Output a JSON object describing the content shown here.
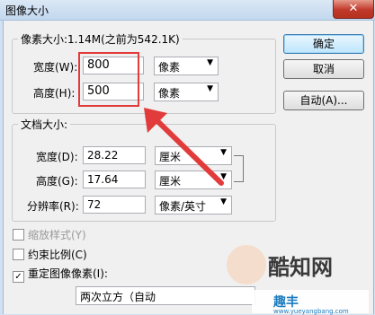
{
  "window": {
    "title": "图像大小",
    "close_symbol": "✕"
  },
  "pixel_dimensions": {
    "legend": "像素大小:1.14M(之前为542.1K)",
    "width_label": "宽度(W):",
    "width_value": "800",
    "width_unit": "像素",
    "height_label": "高度(H):",
    "height_value": "500",
    "height_unit": "像素"
  },
  "document_size": {
    "legend": "文档大小:",
    "width_label": "宽度(D):",
    "width_value": "28.22",
    "width_unit": "厘米",
    "height_label": "高度(G):",
    "height_value": "17.64",
    "height_unit": "厘米",
    "resolution_label": "分辨率(R):",
    "resolution_value": "72",
    "resolution_unit": "像素/英寸"
  },
  "buttons": {
    "ok": "确定",
    "cancel": "取消",
    "auto": "自动(A)..."
  },
  "options": {
    "scale_styles": "缩放样式(Y)",
    "constrain_proportions": "约束比例(C)",
    "resample": "重定图像像素(I):",
    "resample_checkmark": "✓",
    "resample_method": "两次立方（自动"
  },
  "watermark": {
    "brand1": "酷知网",
    "brand2": "趣丰",
    "brand2_url": "www.yueyangbang.com"
  },
  "annotation": {
    "color": "#e23b3b"
  }
}
